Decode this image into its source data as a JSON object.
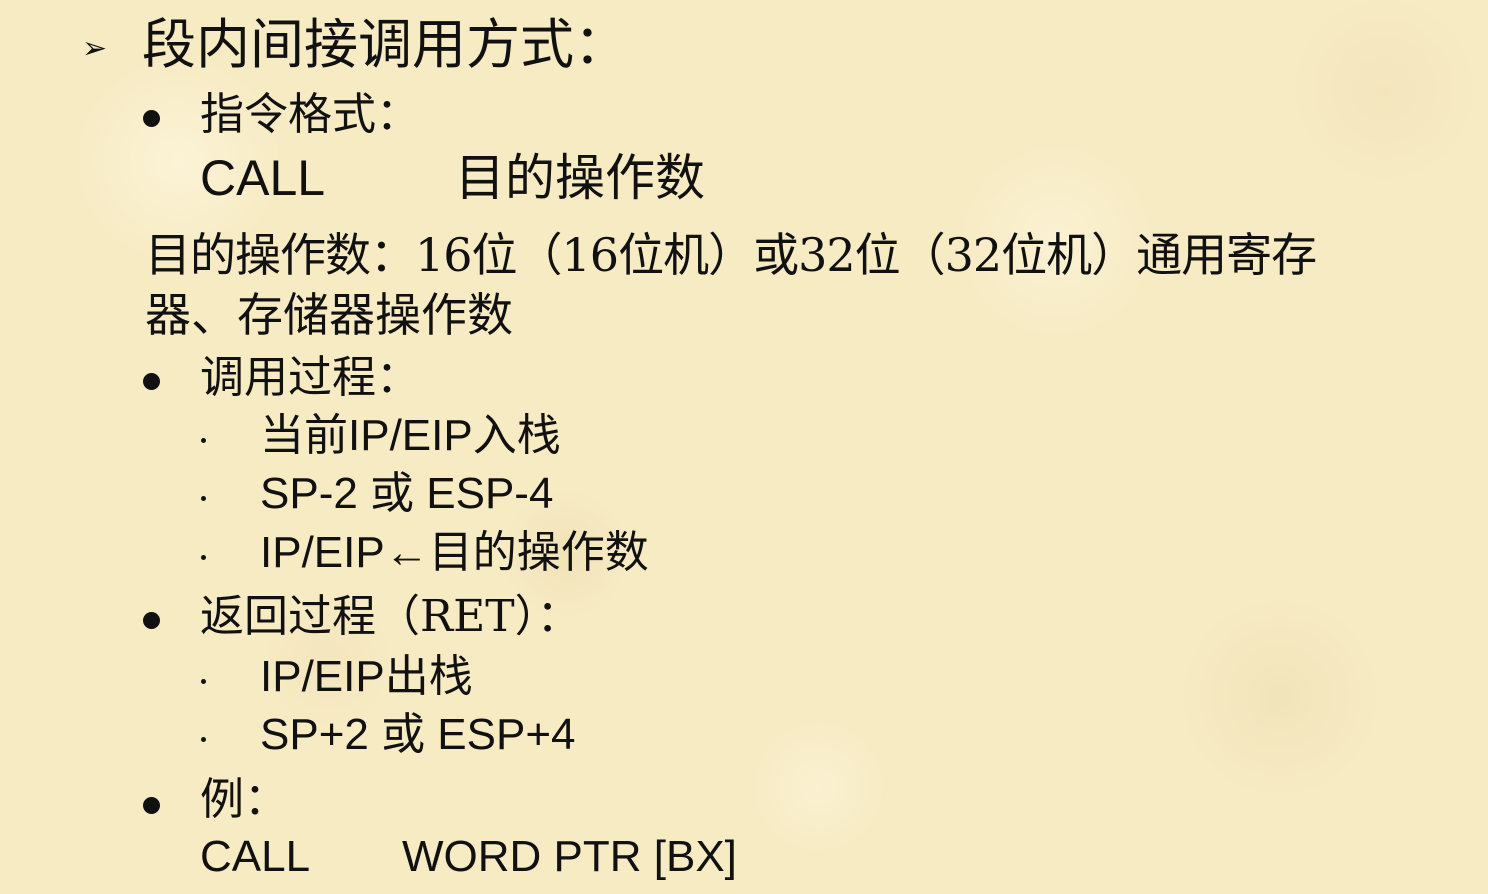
{
  "slide": {
    "title": "段内间接调用方式：",
    "sections": [
      {
        "heading": "指令格式：",
        "code_op": "CALL",
        "code_arg": "目的操作数"
      },
      {
        "desc_line1": "目的操作数：16位（16位机）或32位（32位机）通用寄存",
        "desc_line2": "器、存储器操作数"
      },
      {
        "heading": "调用过程：",
        "items": [
          "当前IP/EIP入栈",
          "SP-2 或 ESP-4",
          "IP/EIP←目的操作数"
        ]
      },
      {
        "heading": "返回过程（RET）：",
        "items": [
          "IP/EIP出栈",
          "SP+2 或 ESP+4"
        ]
      },
      {
        "heading": "例：",
        "code_op": "CALL",
        "code_arg": "WORD PTR [BX]"
      }
    ]
  }
}
